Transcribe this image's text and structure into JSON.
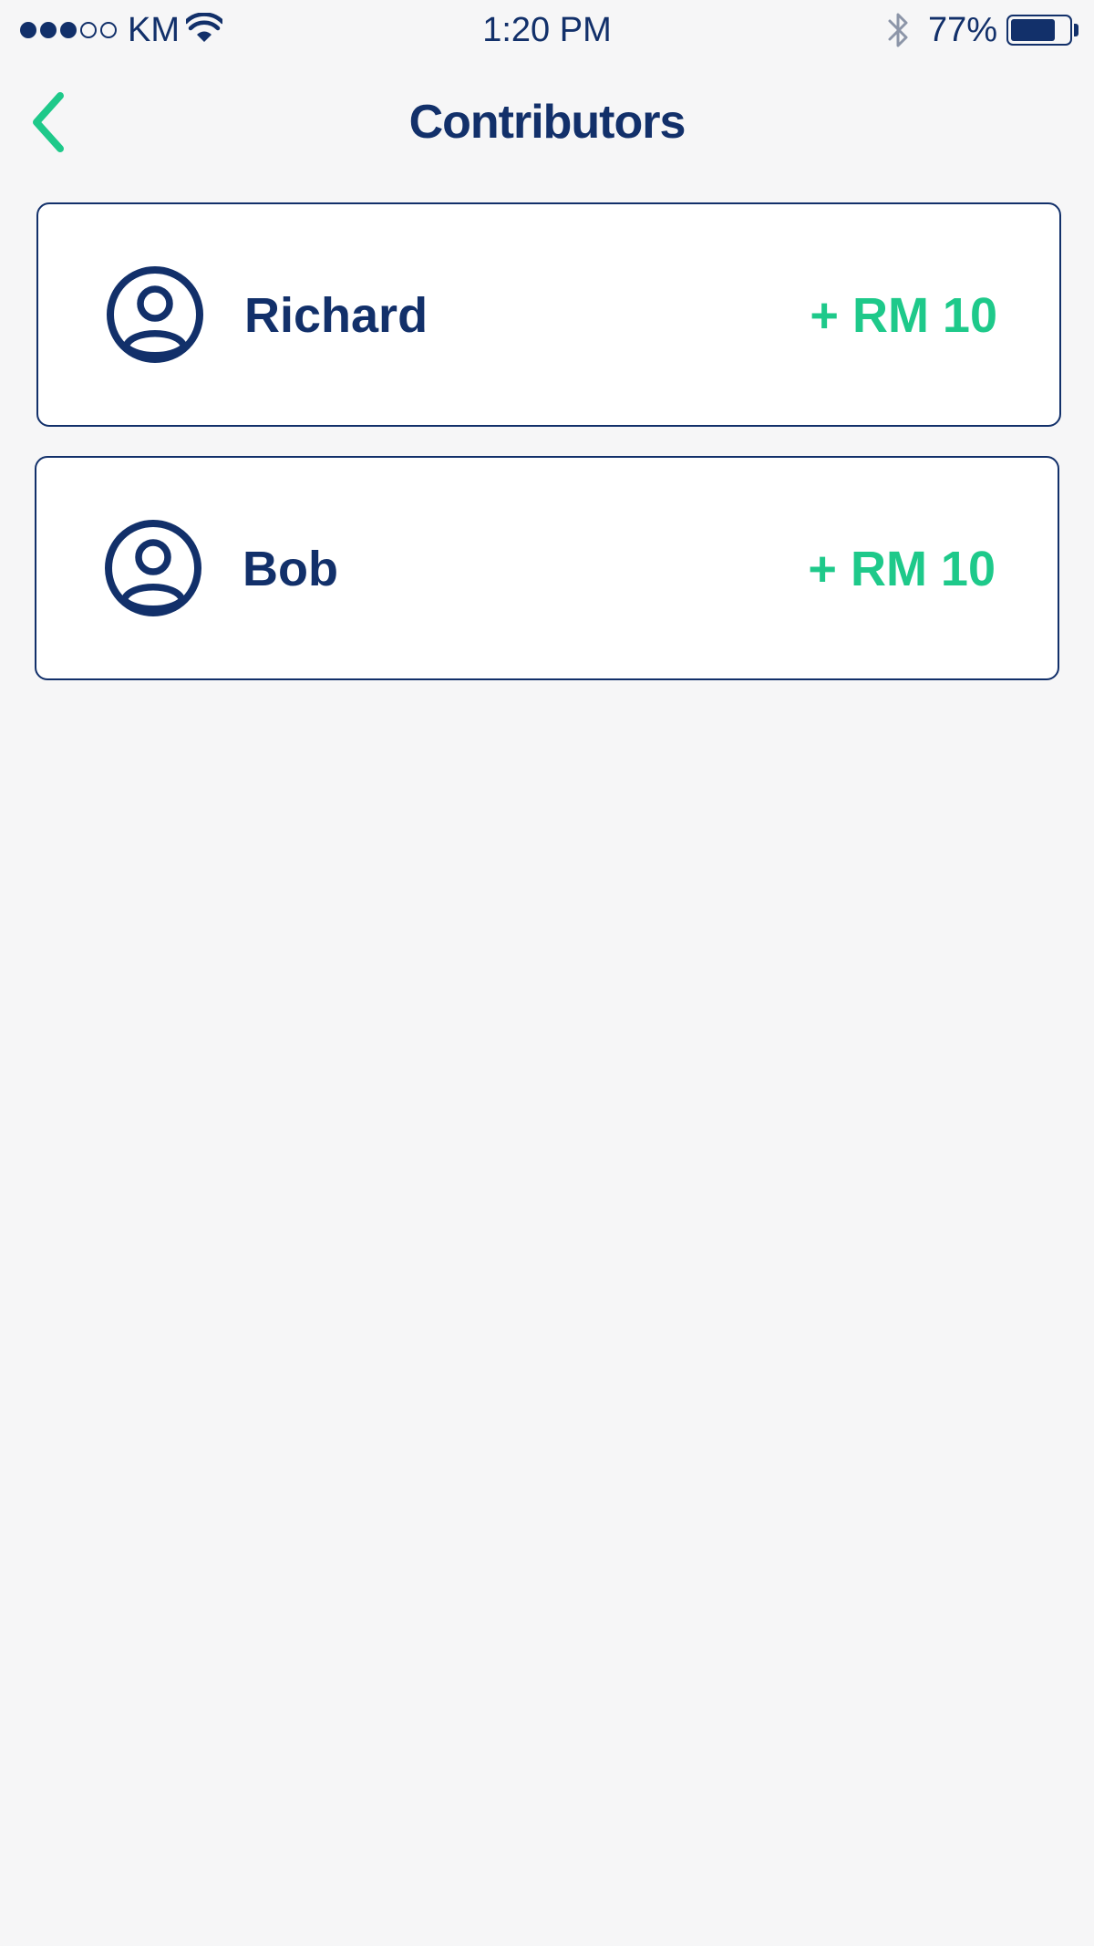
{
  "status_bar": {
    "signal_bars_filled": 3,
    "signal_bars_total": 5,
    "carrier": "KM",
    "time": "1:20 PM",
    "battery_percent": "77%",
    "battery_level": 0.77
  },
  "nav": {
    "title": "Contributors",
    "back_icon": "chevron-left-icon"
  },
  "colors": {
    "primary": "#12306a",
    "accent": "#1ec98a",
    "background": "#f6f6f7",
    "card": "#ffffff"
  },
  "contributors": [
    {
      "name": "Richard",
      "amount": "+ RM 10",
      "avatar_icon": "user-circle-icon"
    },
    {
      "name": "Bob",
      "amount": "+ RM 10",
      "avatar_icon": "user-circle-icon"
    }
  ]
}
